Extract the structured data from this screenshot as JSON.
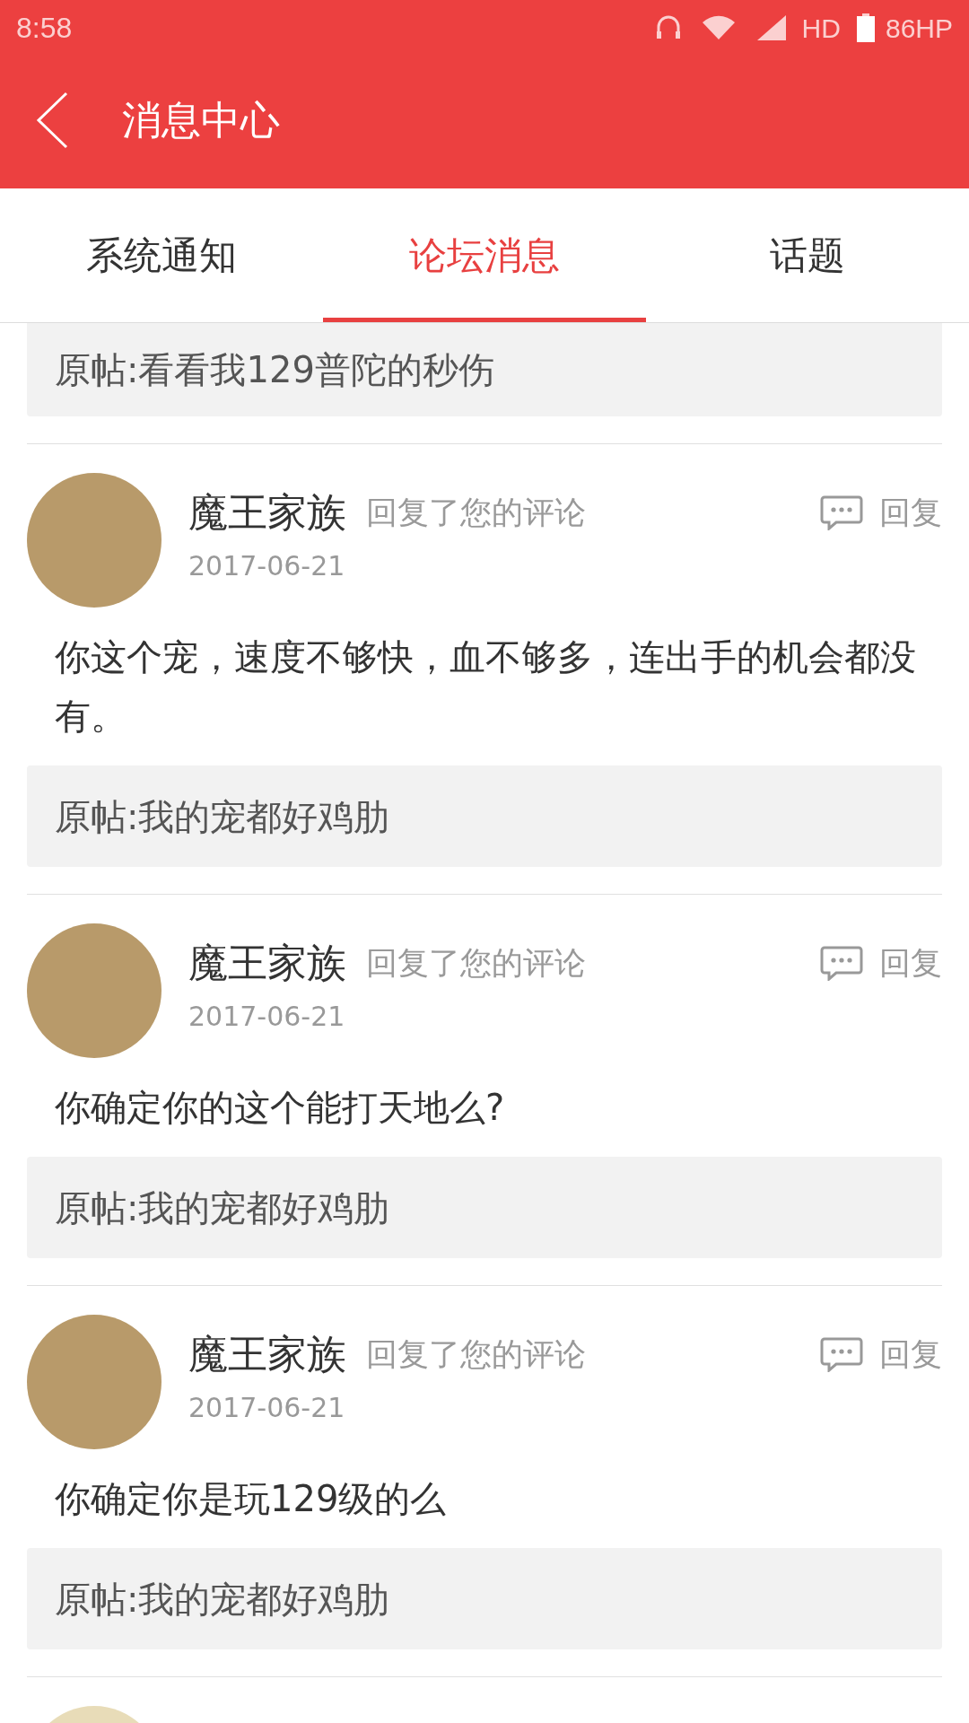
{
  "status_bar": {
    "time": "8:58",
    "network": "HD",
    "battery": "86HP"
  },
  "header": {
    "title": "消息中心"
  },
  "tabs": [
    {
      "label": "系统通知",
      "selected": false
    },
    {
      "label": "论坛消息",
      "selected": true
    },
    {
      "label": "话题",
      "selected": false
    }
  ],
  "top_original_post": "原帖:看看我129普陀的秒伤",
  "messages": [
    {
      "user": "魔王家族",
      "action": "回复了您的评论",
      "date": "2017-06-21",
      "reply_label": "回复",
      "content": "你这个宠，速度不够快，血不够多，连出手的机会都没有。",
      "original_post": "原帖:我的宠都好鸡肋"
    },
    {
      "user": "魔王家族",
      "action": "回复了您的评论",
      "date": "2017-06-21",
      "reply_label": "回复",
      "content": "你确定你的这个能打天地么?",
      "original_post": "原帖:我的宠都好鸡肋"
    },
    {
      "user": "魔王家族",
      "action": "回复了您的评论",
      "date": "2017-06-21",
      "reply_label": "回复",
      "content": "你确定你是玩129级的么",
      "original_post": "原帖:我的宠都好鸡肋"
    }
  ]
}
